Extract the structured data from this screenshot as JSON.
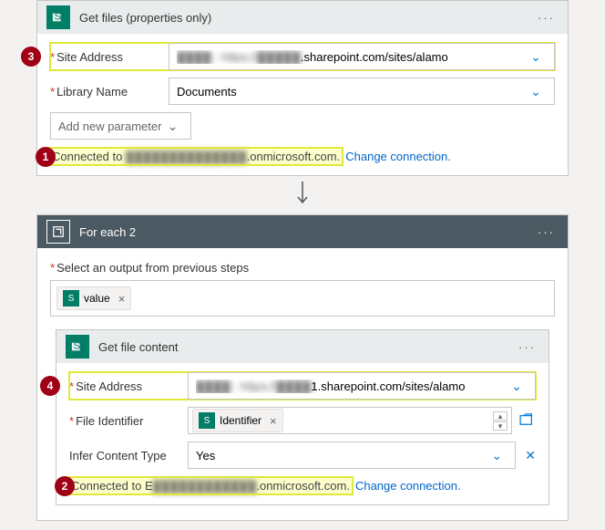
{
  "action1": {
    "title": "Get files (properties only)",
    "fields": {
      "siteAddress": {
        "label": "Site Address",
        "value_prefix": "▓▓▓▓ - https://",
        "value_blur": "▓▓▓▓▓",
        "value_suffix": ".sharepoint.com/sites/alamo"
      },
      "libraryName": {
        "label": "Library Name",
        "value": "Documents"
      },
      "addParam": {
        "placeholder": "Add new parameter"
      }
    },
    "connection": {
      "prefix": "Connected to ",
      "blur": "▓▓▓▓▓▓▓▓▓▓▓▓▓▓",
      "suffix": ".onmicrosoft.com."
    },
    "changeLink": "Change connection."
  },
  "loop": {
    "title": "For each 2",
    "selectLabel": "Select an output from previous steps",
    "token": "value"
  },
  "action2": {
    "title": "Get file content",
    "fields": {
      "siteAddress": {
        "label": "Site Address",
        "value_prefix": "▓▓▓▓ - https://",
        "value_blur": "▓▓▓▓",
        "value_suffix": "1.sharepoint.com/sites/alamo"
      },
      "fileId": {
        "label": "File Identifier",
        "token": "Identifier"
      },
      "inferType": {
        "label": "Infer Content Type",
        "value": "Yes"
      }
    },
    "connection": {
      "prefix": "Connected to E",
      "blur": "▓▓▓▓▓▓▓▓▓▓▓▓",
      "suffix": ".onmicrosoft.com."
    },
    "changeLink": "Change connection."
  },
  "callouts": {
    "c1": "1",
    "c2": "2",
    "c3": "3",
    "c4": "4"
  }
}
